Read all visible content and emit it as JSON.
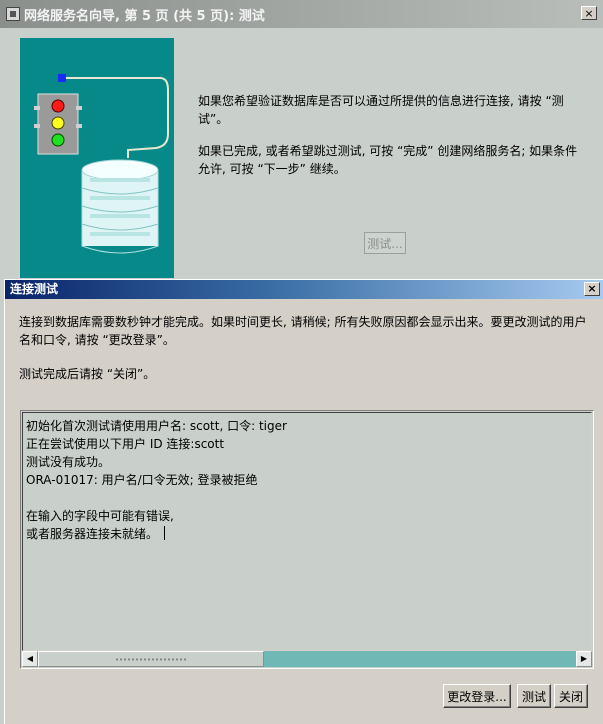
{
  "wizard": {
    "title": "网络服务名向导, 第 5 页 (共 5 页): 测试",
    "close_glyph": "×",
    "paragraph1": "如果您希望验证数据库是否可以通过所提供的信息进行连接, 请按 “测试”。",
    "paragraph2": "如果已完成, 或者希望跳过测试, 可按 “完成” 创建网络服务名; 如果条件允许, 可按 “下一步” 继续。",
    "test_button": "测试..."
  },
  "dialog": {
    "title": "连接测试",
    "close_glyph": "×",
    "intro1": "连接到数据库需要数秒钟才能完成。如果时间更长, 请稍候; 所有失败原因都会显示出来。要更改测试的用户名和口令, 请按 “更改登录”。",
    "intro2": "测试完成后请按 “关闭”。",
    "log_lines": [
      "初始化首次测试请使用用户名: scott, 口令: tiger",
      "正在尝试使用以下用户 ID 连接:scott",
      "测试没有成功。",
      "ORA-01017: 用户名/口令无效; 登录被拒绝",
      "",
      "在输入的字段中可能有错误,",
      "或者服务器连接未就绪。"
    ],
    "scrollbar": {
      "left_arrow": "◀",
      "right_arrow": "▶",
      "position": 0,
      "visible_fraction": 0.42
    },
    "buttons": {
      "change_login": "更改登录...",
      "test": "测试",
      "close": "关闭"
    }
  },
  "colors": {
    "teal_art": "#068988",
    "dialog_title": "#0a246a",
    "scroll_track": "#6fb8b6"
  }
}
